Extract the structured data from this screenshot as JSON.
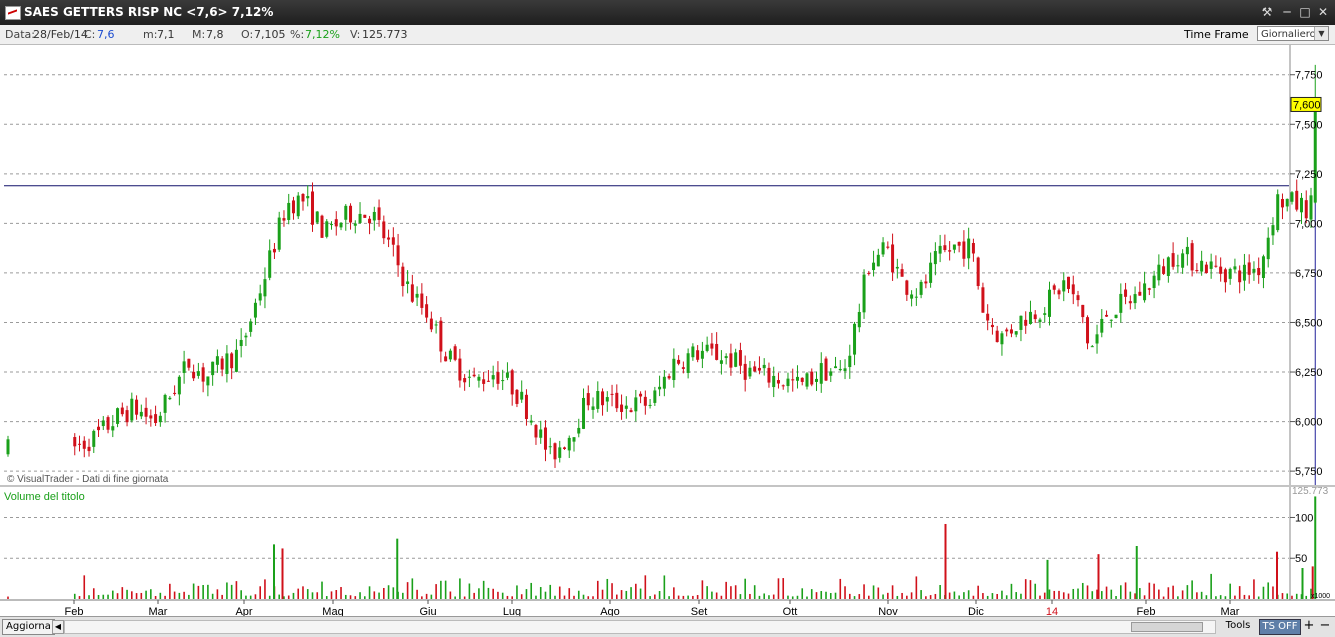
{
  "window": {
    "title": "SAES GETTERS RISP NC <7,6> 7,12%",
    "tools_icon": "wrench-icon",
    "minimize_icon": "minimize-icon",
    "maximize_icon": "maximize-icon",
    "close_icon": "close-icon"
  },
  "infobar": {
    "date_label": "Data:",
    "date_value": "28/Feb/14",
    "close_label": "C:",
    "close_value": "7,6",
    "min_label": "m:",
    "min_value": "7,1",
    "max_label": "M:",
    "max_value": "7,8",
    "open_label": "O:",
    "open_value": "7,105",
    "pct_label": "%:",
    "pct_value": "7,12%",
    "vol_label": "V:",
    "vol_value": "125.773",
    "timeframe_label": "Time Frame",
    "timeframe_value": "Giornaliero"
  },
  "bottombar": {
    "refresh_label": "Aggiorna",
    "tools_label": "Tools",
    "ts_label": "TS OFF",
    "plus_label": "+",
    "minus_label": "−"
  },
  "colors": {
    "up": "#1aa01a",
    "down": "#d0101a",
    "resistance_line": "#10106a",
    "last_price_bg": "#ffff00"
  },
  "chart_data": {
    "type": "candlestick",
    "watermark": "© VisualTrader - Dati di fine giornata",
    "price_axis": {
      "ticks": [
        "7,750",
        "7,500",
        "7,250",
        "7,000",
        "6,750",
        "6,500",
        "6,250",
        "6,000",
        "5,750"
      ],
      "tick_values": [
        7.75,
        7.5,
        7.25,
        7.0,
        6.75,
        6.5,
        6.25,
        6.0,
        5.75
      ],
      "ylim": [
        5.68,
        7.9
      ],
      "last_price_label": "7,600",
      "last_price": 7.6
    },
    "resistance_level": 7.19,
    "x_labels": [
      "Feb",
      "Mar",
      "Apr",
      "Mag",
      "Giu",
      "Lug",
      "Ago",
      "Set",
      "Ott",
      "Nov",
      "Dic",
      "14",
      "Feb",
      "Mar"
    ],
    "x_label_colors": [
      "#000",
      "#000",
      "#000",
      "#000",
      "#000",
      "#000",
      "#000",
      "#000",
      "#000",
      "#000",
      "#000",
      "#d0101a",
      "#000",
      "#000"
    ],
    "price_anchors": [
      {
        "month": 0.0,
        "price": 5.86
      },
      {
        "month": 0.3,
        "price": 5.92
      },
      {
        "month": 0.55,
        "price": 6.02
      },
      {
        "month": 0.75,
        "price": 6.07
      },
      {
        "month": 1.0,
        "price": 6.0
      },
      {
        "month": 1.2,
        "price": 6.15
      },
      {
        "month": 1.4,
        "price": 6.3
      },
      {
        "month": 1.6,
        "price": 6.22
      },
      {
        "month": 1.8,
        "price": 6.3
      },
      {
        "month": 2.0,
        "price": 6.35
      },
      {
        "month": 2.3,
        "price": 6.75
      },
      {
        "month": 2.55,
        "price": 7.1
      },
      {
        "month": 2.75,
        "price": 7.12
      },
      {
        "month": 3.0,
        "price": 6.95
      },
      {
        "month": 3.3,
        "price": 7.05
      },
      {
        "month": 3.55,
        "price": 7.05
      },
      {
        "month": 3.8,
        "price": 6.85
      },
      {
        "month": 4.0,
        "price": 6.65
      },
      {
        "month": 4.2,
        "price": 6.55
      },
      {
        "month": 4.45,
        "price": 6.32
      },
      {
        "month": 4.75,
        "price": 6.2
      },
      {
        "month": 5.0,
        "price": 6.25
      },
      {
        "month": 5.2,
        "price": 6.18
      },
      {
        "month": 5.4,
        "price": 6.05
      },
      {
        "month": 5.65,
        "price": 5.82
      },
      {
        "month": 5.9,
        "price": 5.95
      },
      {
        "month": 6.1,
        "price": 6.12
      },
      {
        "month": 6.35,
        "price": 6.1
      },
      {
        "month": 6.6,
        "price": 6.08
      },
      {
        "month": 6.85,
        "price": 6.1
      },
      {
        "month": 7.1,
        "price": 6.3
      },
      {
        "month": 7.4,
        "price": 6.35
      },
      {
        "month": 7.7,
        "price": 6.33
      },
      {
        "month": 8.0,
        "price": 6.25
      },
      {
        "month": 8.3,
        "price": 6.22
      },
      {
        "month": 8.6,
        "price": 6.18
      },
      {
        "month": 8.85,
        "price": 6.26
      },
      {
        "month": 9.1,
        "price": 6.25
      },
      {
        "month": 9.25,
        "price": 6.5
      },
      {
        "month": 9.4,
        "price": 6.8
      },
      {
        "month": 9.6,
        "price": 6.88
      },
      {
        "month": 9.8,
        "price": 6.7
      },
      {
        "month": 10.0,
        "price": 6.65
      },
      {
        "month": 10.2,
        "price": 6.82
      },
      {
        "month": 10.4,
        "price": 6.88
      },
      {
        "month": 10.6,
        "price": 6.88
      },
      {
        "month": 10.75,
        "price": 6.55
      },
      {
        "month": 10.95,
        "price": 6.42
      },
      {
        "month": 11.2,
        "price": 6.52
      },
      {
        "month": 11.45,
        "price": 6.58
      },
      {
        "month": 11.7,
        "price": 6.7
      },
      {
        "month": 11.9,
        "price": 6.55
      },
      {
        "month": 12.0,
        "price": 6.35
      },
      {
        "month": 12.2,
        "price": 6.55
      },
      {
        "month": 12.5,
        "price": 6.62
      },
      {
        "month": 12.75,
        "price": 6.72
      },
      {
        "month": 13.0,
        "price": 6.85
      },
      {
        "month": 13.3,
        "price": 6.8
      },
      {
        "month": 13.55,
        "price": 6.76
      },
      {
        "month": 13.8,
        "price": 6.75
      },
      {
        "month": 14.0,
        "price": 6.78
      },
      {
        "month": 14.2,
        "price": 7.12
      },
      {
        "month": 14.4,
        "price": 7.1
      },
      {
        "month": 14.55,
        "price": 7.08
      },
      {
        "month": 14.65,
        "price": 7.105
      }
    ],
    "last_candle": {
      "open": 7.105,
      "high": 7.8,
      "low": 7.1,
      "close": 7.6
    },
    "volume_panel": {
      "title": "Volume del titolo",
      "ticks": [
        "100",
        "50"
      ],
      "tick_values": [
        100,
        50
      ],
      "ylim": [
        0,
        130
      ],
      "last_label": "125.773",
      "unit_label": "x1000",
      "spikes": [
        {
          "month": 2.4,
          "value": 67
        },
        {
          "month": 2.5,
          "value": 62
        },
        {
          "month": 3.85,
          "value": 74
        },
        {
          "month": 10.3,
          "value": 92
        },
        {
          "month": 11.5,
          "value": 48
        },
        {
          "month": 12.1,
          "value": 55
        },
        {
          "month": 12.55,
          "value": 65
        },
        {
          "month": 14.2,
          "value": 58
        },
        {
          "month": 14.5,
          "value": 38
        },
        {
          "month": 14.62,
          "value": 40
        },
        {
          "month": 14.65,
          "value": 125.773
        }
      ]
    }
  }
}
